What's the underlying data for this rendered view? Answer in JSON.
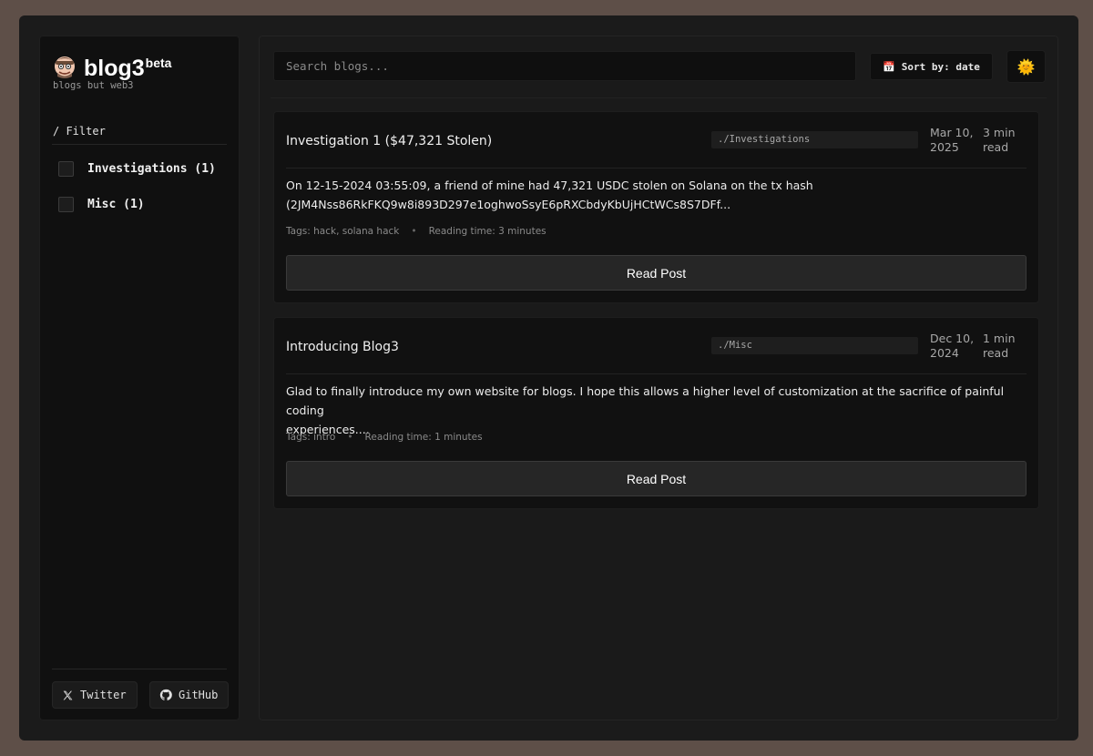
{
  "brand": {
    "name": "blog3",
    "sup": "beta",
    "tagline": "blogs but web3"
  },
  "sidebar": {
    "filter_title": "/ Filter",
    "filters": [
      {
        "label": "Investigations (1)",
        "checked": false
      },
      {
        "label": "Misc (1)",
        "checked": false
      }
    ],
    "social": [
      {
        "label": "Twitter",
        "icon": "x-twitter-icon"
      },
      {
        "label": "GitHub",
        "icon": "github-icon"
      }
    ]
  },
  "toolbar": {
    "search_placeholder": "Search blogs...",
    "sort_icon": "calendar-icon",
    "sort_label": "Sort by: date",
    "theme_icon": "sun-icon"
  },
  "posts": [
    {
      "title": "Investigation 1 ($47,321 Stolen)",
      "category": "./Investigations",
      "date_line1": "Mar 10,",
      "date_line2": "2025",
      "read_line1": "3 min",
      "read_line2": "read",
      "excerpt_line1": "On 12-15-2024 03:55:09, a friend of mine had 47,321 USDC stolen on Solana on the tx hash",
      "excerpt_line2": "(2JM4Nss86RkFKQ9w8i893D297e1oghwoSsyE6pRXCbdyKbUjHCtWCs8S7DFf...",
      "tags": "Tags: hack, solana hack",
      "reading_time": "Reading time: 3 minutes",
      "button": "Read Post"
    },
    {
      "title": "Introducing Blog3",
      "category": "./Misc",
      "date_line1": "Dec 10,",
      "date_line2": "2024",
      "read_line1": "1 min",
      "read_line2": "read",
      "excerpt_line1": "Glad to finally introduce my own website for blogs. I hope this allows a higher level of customization at the sacrifice of painful coding",
      "excerpt_line2": "experiences....",
      "tags": "Tags: intro",
      "reading_time": "Reading time: 1 minutes",
      "button": "Read Post"
    }
  ],
  "colors": {
    "background": "#5e4f48",
    "window": "#1b1b1b",
    "panel": "#101010",
    "button": "#262626"
  }
}
